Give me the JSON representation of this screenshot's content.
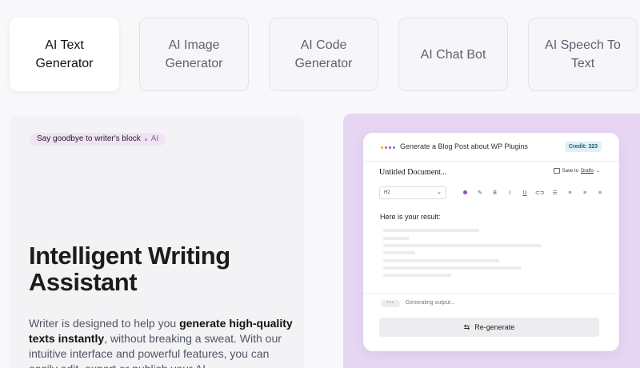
{
  "tabs": [
    {
      "label": "AI Text Generator",
      "active": true
    },
    {
      "label": "AI Image Generator",
      "active": false
    },
    {
      "label": "AI Code Generator",
      "active": false
    },
    {
      "label": "AI Chat Bot",
      "active": false
    },
    {
      "label": "AI Speech To Text",
      "active": false
    }
  ],
  "hero": {
    "pill_text": "Say goodbye to writer's block",
    "pill_tag": "AI",
    "headline": "Intelligent Writing Assistant",
    "desc_part1": "Writer is designed to help you ",
    "desc_bold": "generate high-quality texts instantly",
    "desc_part2": ", without breaking a sweat. With our intuitive interface and powerful features, you can easily edit, export or publish your AI"
  },
  "editor": {
    "header_title": "Generate a Blog Post about WP Plugins",
    "credit": "Credit: 323",
    "doc_title": "Untitled Document...",
    "save_prefix": "Save to",
    "save_target": "Drafts",
    "heading_select": "H2",
    "result_label": "Here is your result:",
    "status": "Generating output...",
    "regenerate_label": "Re-generate",
    "dot_colors": [
      "#f5a623",
      "#e94e77",
      "#8e4fb8",
      "#4a90d9"
    ],
    "icons": [
      "color-dot-icon",
      "pen-icon",
      "bold-icon",
      "italic-icon",
      "underline-icon",
      "link-icon",
      "list-icon",
      "align-left-icon",
      "align-center-icon",
      "align-right-icon"
    ]
  },
  "colors": {
    "accent": "#8e4fb8",
    "panel_bg": "#e6d6f4",
    "pill_bg": "#f1e3f4"
  }
}
